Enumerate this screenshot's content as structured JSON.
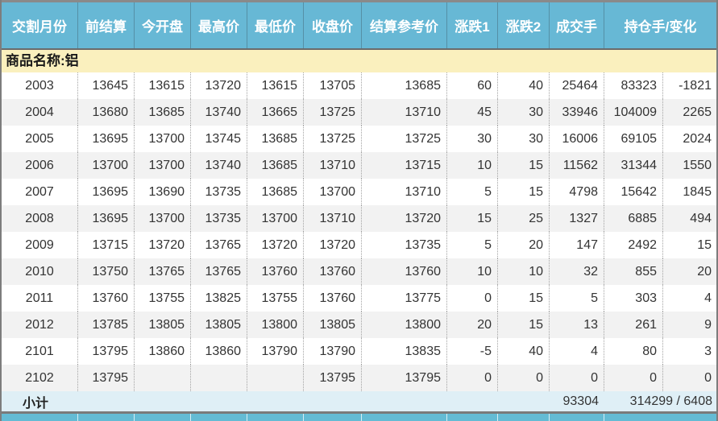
{
  "table": {
    "columns": [
      "交割月份",
      "前结算",
      "今开盘",
      "最高价",
      "最低价",
      "收盘价",
      "结算参考价",
      "涨跌1",
      "涨跌2",
      "成交手",
      "持仓手/变化"
    ],
    "product_row_label": "商品名称:铝",
    "rows": [
      {
        "month": "2003",
        "prev_settle": "13645",
        "open": "13615",
        "high": "13720",
        "low": "13615",
        "close": "13705",
        "settle_ref": "13685",
        "change1": "60",
        "change2": "40",
        "volume": "25464",
        "open_interest": "83323",
        "oi_change": "-1821"
      },
      {
        "month": "2004",
        "prev_settle": "13680",
        "open": "13685",
        "high": "13740",
        "low": "13665",
        "close": "13725",
        "settle_ref": "13710",
        "change1": "45",
        "change2": "30",
        "volume": "33946",
        "open_interest": "104009",
        "oi_change": "2265"
      },
      {
        "month": "2005",
        "prev_settle": "13695",
        "open": "13700",
        "high": "13745",
        "low": "13685",
        "close": "13725",
        "settle_ref": "13725",
        "change1": "30",
        "change2": "30",
        "volume": "16006",
        "open_interest": "69105",
        "oi_change": "2024"
      },
      {
        "month": "2006",
        "prev_settle": "13700",
        "open": "13700",
        "high": "13740",
        "low": "13685",
        "close": "13710",
        "settle_ref": "13715",
        "change1": "10",
        "change2": "15",
        "volume": "11562",
        "open_interest": "31344",
        "oi_change": "1550"
      },
      {
        "month": "2007",
        "prev_settle": "13695",
        "open": "13690",
        "high": "13735",
        "low": "13685",
        "close": "13700",
        "settle_ref": "13710",
        "change1": "5",
        "change2": "15",
        "volume": "4798",
        "open_interest": "15642",
        "oi_change": "1845"
      },
      {
        "month": "2008",
        "prev_settle": "13695",
        "open": "13700",
        "high": "13735",
        "low": "13700",
        "close": "13710",
        "settle_ref": "13720",
        "change1": "15",
        "change2": "25",
        "volume": "1327",
        "open_interest": "6885",
        "oi_change": "494"
      },
      {
        "month": "2009",
        "prev_settle": "13715",
        "open": "13720",
        "high": "13765",
        "low": "13720",
        "close": "13720",
        "settle_ref": "13735",
        "change1": "5",
        "change2": "20",
        "volume": "147",
        "open_interest": "2492",
        "oi_change": "15"
      },
      {
        "month": "2010",
        "prev_settle": "13750",
        "open": "13765",
        "high": "13765",
        "low": "13760",
        "close": "13760",
        "settle_ref": "13760",
        "change1": "10",
        "change2": "10",
        "volume": "32",
        "open_interest": "855",
        "oi_change": "20"
      },
      {
        "month": "2011",
        "prev_settle": "13760",
        "open": "13755",
        "high": "13825",
        "low": "13755",
        "close": "13760",
        "settle_ref": "13775",
        "change1": "0",
        "change2": "15",
        "volume": "5",
        "open_interest": "303",
        "oi_change": "4"
      },
      {
        "month": "2012",
        "prev_settle": "13785",
        "open": "13805",
        "high": "13805",
        "low": "13800",
        "close": "13805",
        "settle_ref": "13800",
        "change1": "20",
        "change2": "15",
        "volume": "13",
        "open_interest": "261",
        "oi_change": "9"
      },
      {
        "month": "2101",
        "prev_settle": "13795",
        "open": "13860",
        "high": "13860",
        "low": "13790",
        "close": "13790",
        "settle_ref": "13835",
        "change1": "-5",
        "change2": "40",
        "volume": "4",
        "open_interest": "80",
        "oi_change": "3"
      },
      {
        "month": "2102",
        "prev_settle": "13795",
        "open": "",
        "high": "",
        "low": "",
        "close": "13795",
        "settle_ref": "13795",
        "change1": "0",
        "change2": "0",
        "volume": "0",
        "open_interest": "0",
        "oi_change": "0"
      }
    ],
    "subtotal": {
      "label": "小计",
      "volume": "93304",
      "oi_total": "314299 / 6408"
    }
  },
  "colors": {
    "header_bg": "#67b8d5",
    "header_text": "#ffffff",
    "product_band_bg": "#faf0be",
    "row_alt_bg": "#f2f2f2",
    "subtotal_bg": "#dfeff6",
    "outer_border": "#7d7d7d",
    "next_section_bg": "#64bbd4"
  }
}
